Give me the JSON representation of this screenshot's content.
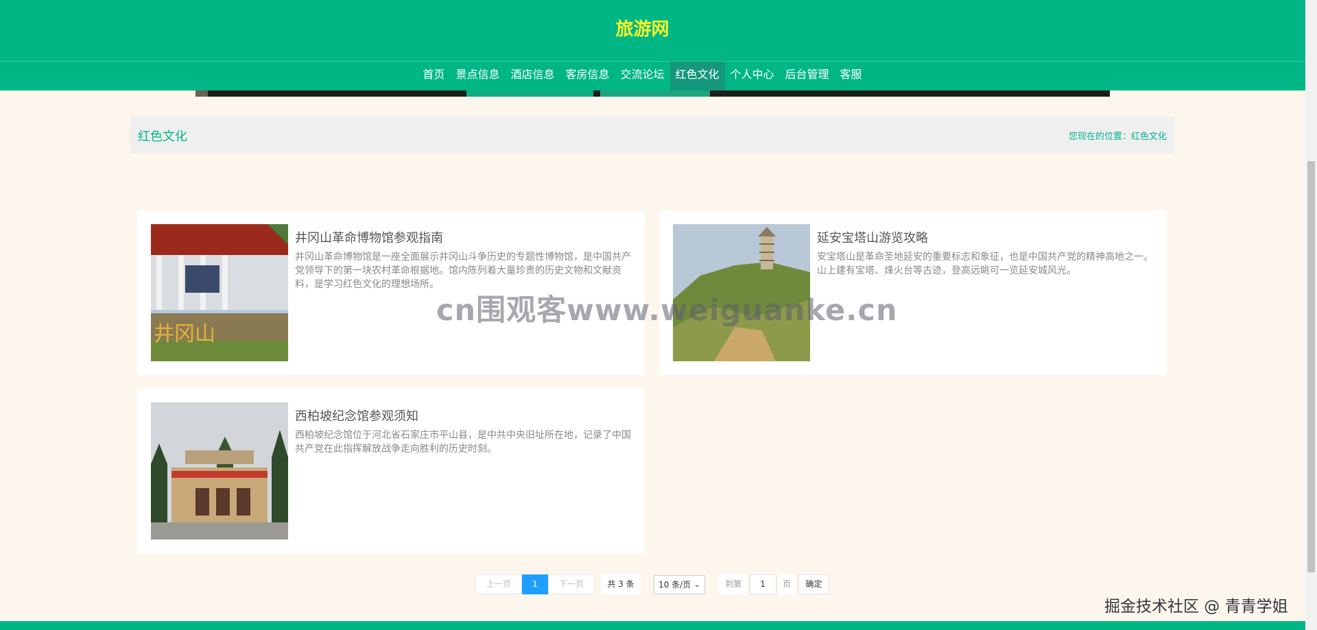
{
  "header": {
    "site_title": "旅游网",
    "nav": [
      {
        "label": "首页",
        "active": false
      },
      {
        "label": "景点信息",
        "active": false
      },
      {
        "label": "酒店信息",
        "active": false
      },
      {
        "label": "客房信息",
        "active": false
      },
      {
        "label": "交流论坛",
        "active": false
      },
      {
        "label": "红色文化",
        "active": true
      },
      {
        "label": "个人中心",
        "active": false
      },
      {
        "label": "后台管理",
        "active": false
      },
      {
        "label": "客服",
        "active": false
      }
    ]
  },
  "page": {
    "title": "红色文化",
    "breadcrumb": "您现在的位置：红色文化"
  },
  "articles": [
    {
      "title": "井冈山革命博物馆参观指南",
      "description": "井冈山革命博物馆是一座全面展示井冈山斗争历史的专题性博物馆，是中国共产党领导下的第一块农村革命根据地。馆内陈列着大量珍贵的历史文物和文献资料，是学习红色文化的理想场所。",
      "image_text": "井冈山"
    },
    {
      "title": "延安宝塔山游览攻略",
      "description": "安宝塔山是革命圣地延安的重要标志和象征，也是中国共产党的精神高地之一。山上建有宝塔、烽火台等古迹，登高远眺可一览延安城风光。",
      "image_text": ""
    },
    {
      "title": "西柏坡纪念馆参观须知",
      "description": "西柏坡纪念馆位于河北省石家庄市平山县，是中共中央旧址所在地，记录了中国共产党在此指挥解放战争走向胜利的历史时刻。",
      "image_text": ""
    }
  ],
  "pagination": {
    "prev": "上一页",
    "current_page": "1",
    "next": "下一页",
    "total": "共 3 条",
    "page_size": "10 条/页",
    "goto_label": "到第",
    "goto_value": "1",
    "page_unit": "页",
    "confirm": "确定"
  },
  "watermarks": {
    "center": "cn围观客www.weiguanke.cn",
    "corner": "掘金技术社区 @ 青青学姐"
  },
  "colors": {
    "primary": "#00b685",
    "nav_active": "#14977b",
    "title_yellow": "#f5f22a",
    "page_bg": "#fcf6ec"
  }
}
